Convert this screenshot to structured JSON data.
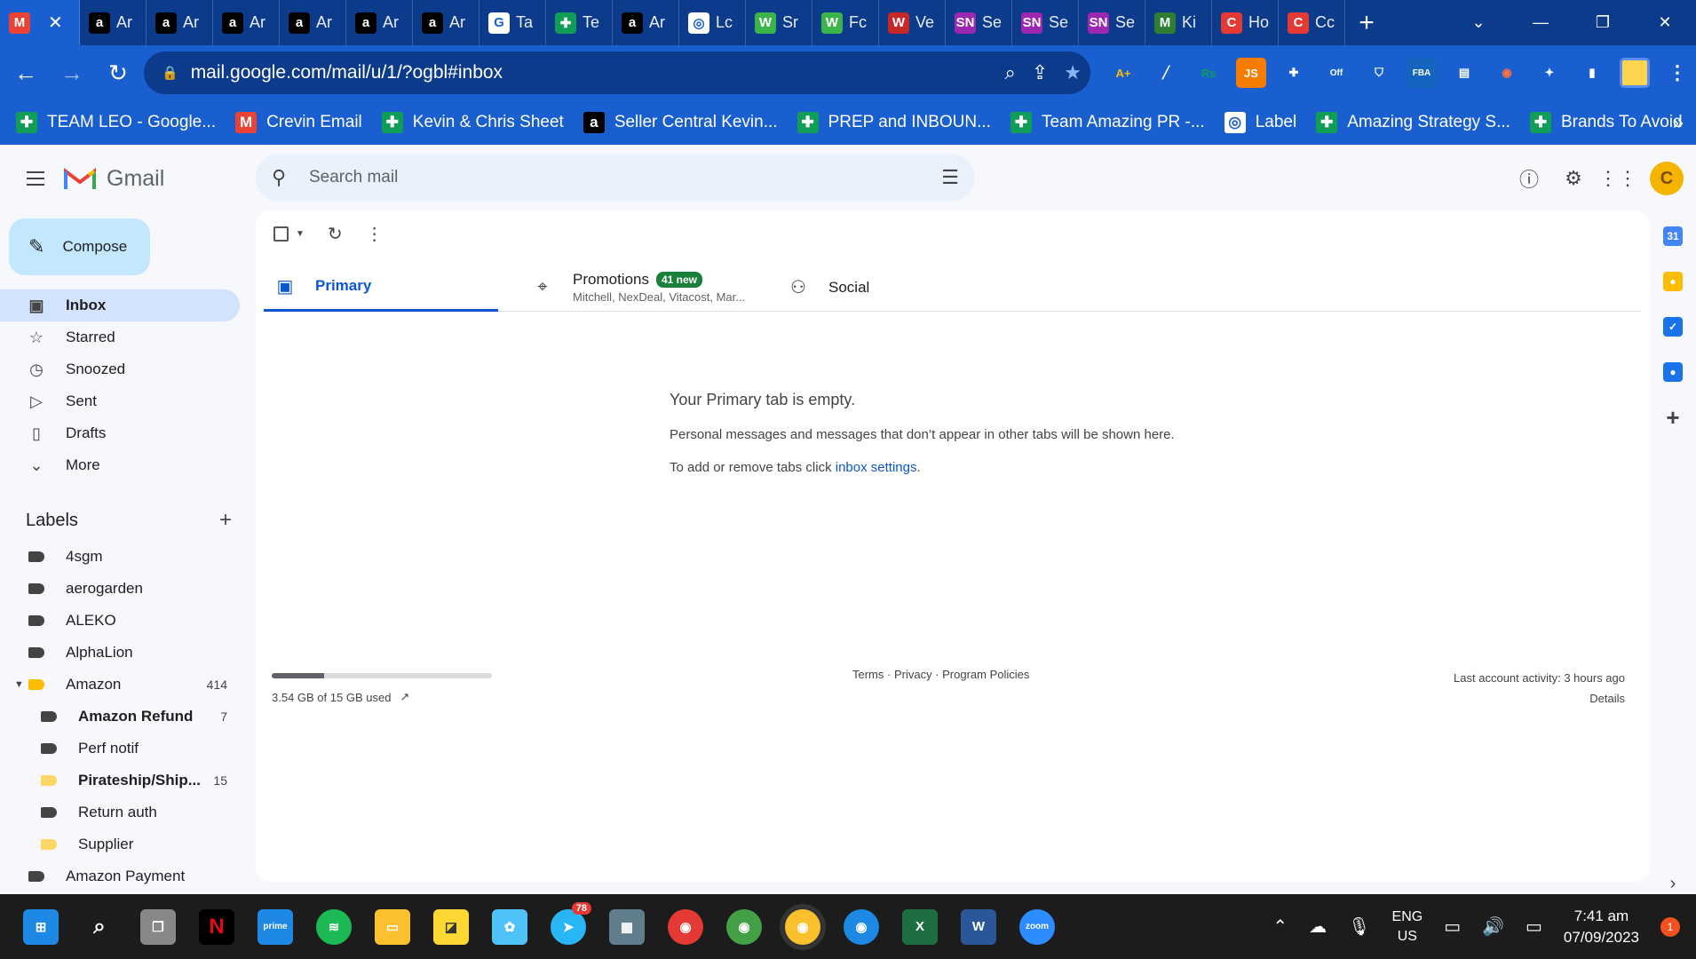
{
  "browser": {
    "tabs": [
      {
        "title": "",
        "icon": "gmail-icon",
        "active": true,
        "color": "#ea4335"
      },
      {
        "title": "Ar",
        "icon": "amazon-icon",
        "color": "#000000"
      },
      {
        "title": "Ar",
        "icon": "amazon-icon",
        "color": "#000000"
      },
      {
        "title": "Ar",
        "icon": "amazon-icon",
        "color": "#000000"
      },
      {
        "title": "Ar",
        "icon": "amazon-icon",
        "color": "#000000"
      },
      {
        "title": "Ar",
        "icon": "amazon-icon",
        "color": "#000000"
      },
      {
        "title": "Ar",
        "icon": "amazon-icon",
        "color": "#000000"
      },
      {
        "title": "Ta",
        "icon": "google-icon",
        "color": "#ffffff"
      },
      {
        "title": "Te",
        "icon": "sheets-icon",
        "color": "#0f9d58"
      },
      {
        "title": "Ar",
        "icon": "amazon-icon",
        "color": "#000000"
      },
      {
        "title": "Lc",
        "icon": "label-icon",
        "color": "#ffffff"
      },
      {
        "title": "Sr",
        "icon": "w-icon",
        "color": "#3bb54a"
      },
      {
        "title": "Fc",
        "icon": "w-icon",
        "color": "#3bb54a"
      },
      {
        "title": "Ve",
        "icon": "ww-icon",
        "color": "#c62828"
      },
      {
        "title": "Se",
        "icon": "sn-icon",
        "color": "#9c27b0"
      },
      {
        "title": "Se",
        "icon": "sn-icon",
        "color": "#9c27b0"
      },
      {
        "title": "Se",
        "icon": "sn-icon",
        "color": "#9c27b0"
      },
      {
        "title": "Ki",
        "icon": "m-icon",
        "color": "#2e7d32"
      },
      {
        "title": "Ho",
        "icon": "c-icon",
        "color": "#e53935"
      },
      {
        "title": "Cc",
        "icon": "c-icon",
        "color": "#e53935"
      }
    ],
    "url": "mail.google.com/mail/u/1/?ogbl#inbox",
    "bookmarks": [
      {
        "label": "TEAM LEO - Google...",
        "icon": "sheets-icon",
        "color": "#0f9d58"
      },
      {
        "label": "Crevin Email",
        "icon": "gmail-icon",
        "color": "#ea4335"
      },
      {
        "label": "Kevin & Chris Sheet",
        "icon": "sheets-icon",
        "color": "#0f9d58"
      },
      {
        "label": "Seller Central Kevin...",
        "icon": "amazon-icon",
        "color": "#000000"
      },
      {
        "label": "PREP and INBOUN...",
        "icon": "sheets-icon",
        "color": "#0f9d58"
      },
      {
        "label": "Team Amazing PR -...",
        "icon": "sheets-icon",
        "color": "#0f9d58"
      },
      {
        "label": "Label",
        "icon": "label-icon",
        "color": "#ffffff"
      },
      {
        "label": "Amazing Strategy S...",
        "icon": "sheets-icon",
        "color": "#0f9d58"
      },
      {
        "label": "Brands To Avoid",
        "icon": "sheets-icon",
        "color": "#0f9d58"
      }
    ]
  },
  "gmail": {
    "brand": "Gmail",
    "search_placeholder": "Search mail",
    "compose_label": "Compose",
    "nav": [
      {
        "label": "Inbox",
        "icon": "inbox-icon",
        "glyph": "▣",
        "active": true
      },
      {
        "label": "Starred",
        "icon": "star-icon",
        "glyph": "☆"
      },
      {
        "label": "Snoozed",
        "icon": "clock-icon",
        "glyph": "◷"
      },
      {
        "label": "Sent",
        "icon": "send-icon",
        "glyph": "▷"
      },
      {
        "label": "Drafts",
        "icon": "draft-icon",
        "glyph": "▯"
      },
      {
        "label": "More",
        "icon": "chevron-down-icon",
        "glyph": "⌄"
      }
    ],
    "labels_title": "Labels",
    "labels": [
      {
        "name": "4sgm",
        "color": "#444444",
        "indent": 0
      },
      {
        "name": "aerogarden",
        "color": "#444444",
        "indent": 0
      },
      {
        "name": "ALEKO",
        "color": "#444444",
        "indent": 0
      },
      {
        "name": "AlphaLion",
        "color": "#444444",
        "indent": 0
      },
      {
        "name": "Amazon",
        "color": "#fbbc04",
        "indent": 0,
        "count": "414",
        "expanded": true
      },
      {
        "name": "Amazon Refund",
        "color": "#444444",
        "indent": 1,
        "count": "7",
        "bold": true
      },
      {
        "name": "Perf notif",
        "color": "#444444",
        "indent": 1
      },
      {
        "name": "Pirateship/Ship...",
        "color": "#fdd663",
        "indent": 1,
        "count": "15",
        "bold": true
      },
      {
        "name": "Return auth",
        "color": "#444444",
        "indent": 1
      },
      {
        "name": "Supplier",
        "color": "#fdd663",
        "indent": 1
      },
      {
        "name": "Amazon Payment",
        "color": "#444444",
        "indent": 0
      }
    ],
    "tabs": {
      "primary": "Primary",
      "promotions": "Promotions",
      "promotions_badge": "41 new",
      "promotions_senders": "Mitchell, NexDeal, Vitacost, Mar...",
      "social": "Social"
    },
    "empty": {
      "title": "Your Primary tab is empty.",
      "line1": "Personal messages and messages that don’t appear in other tabs will be shown here.",
      "line2_prefix": "To add or remove tabs click ",
      "line2_link": "inbox settings",
      "line2_suffix": "."
    },
    "storage": {
      "text": "3.54 GB of 15 GB used",
      "used_fraction": 0.236
    },
    "footer": {
      "terms": "Terms",
      "privacy": "Privacy",
      "policies": "Program Policies",
      "sep": " · "
    },
    "activity": {
      "text": "Last account activity: 3 hours ago",
      "details": "Details"
    },
    "avatar_letter": "C"
  },
  "taskbar": {
    "telegram_badge": "78",
    "lang_top": "ENG",
    "lang_bottom": "US",
    "time": "7:41 am",
    "date": "07/09/2023",
    "notifications": "1"
  }
}
